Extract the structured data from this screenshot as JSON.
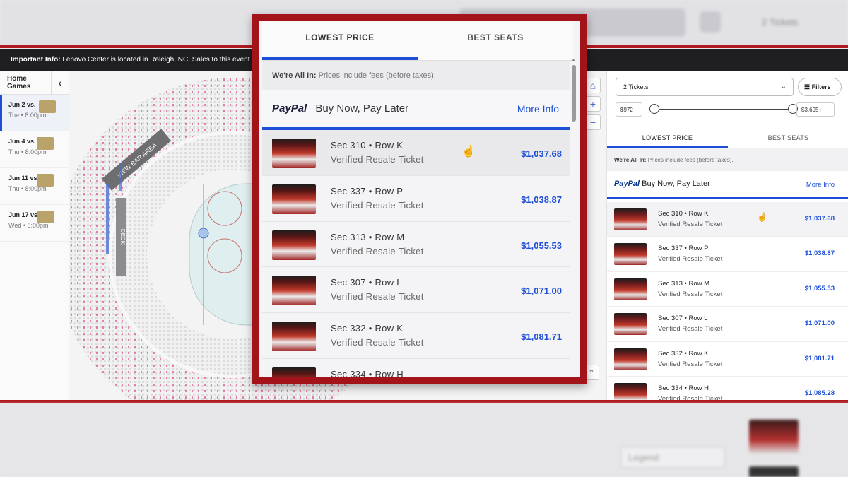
{
  "info_bar": {
    "label": "Important Info:",
    "text": "Lenovo Center is located in Raleigh, NC. Sales to this event will be"
  },
  "sidebar": {
    "title": "Home Games",
    "back_icon": "chevron-left-icon",
    "games": [
      {
        "opponent": "Jun 2 vs.",
        "when": "Tue • 8:00pm"
      },
      {
        "opponent": "Jun 4 vs.",
        "when": "Thu • 8:00pm"
      },
      {
        "opponent": "Jun 11 vs.",
        "when": "Thu • 8:00pm"
      },
      {
        "opponent": "Jun 17 vs.",
        "when": "Wed • 8:00pm"
      }
    ]
  },
  "map": {
    "labels": [
      "VIEW BAR AREA",
      "DECK"
    ]
  },
  "filters": {
    "quantity": "2 Tickets",
    "filters_label": "Filters",
    "price_min": "$972",
    "price_max": "$3,695+"
  },
  "tabs": {
    "lowest": "LOWEST PRICE",
    "best": "BEST SEATS"
  },
  "notice": {
    "bold": "We're All In:",
    "text": "Prices include fees (before taxes)."
  },
  "paypal": {
    "brand": "PayPal",
    "text": "Buy Now, Pay Later",
    "link": "More Info"
  },
  "listings": [
    {
      "section": "Sec 310 • Row K",
      "type": "Verified Resale Ticket",
      "price": "$1,037.68"
    },
    {
      "section": "Sec 337 • Row P",
      "type": "Verified Resale Ticket",
      "price": "$1,038.87"
    },
    {
      "section": "Sec 313 • Row M",
      "type": "Verified Resale Ticket",
      "price": "$1,055.53"
    },
    {
      "section": "Sec 307 • Row L",
      "type": "Verified Resale Ticket",
      "price": "$1,071.00"
    },
    {
      "section": "Sec 332 • Row K",
      "type": "Verified Resale Ticket",
      "price": "$1,081.71"
    },
    {
      "section": "Sec 334 • Row H",
      "type": "Verified Resale Ticket",
      "price": "$1,085.28"
    }
  ],
  "background": {
    "tickets_label": "2 Tickets",
    "legend_label": "Legend"
  },
  "colors": {
    "accent": "#1d4ed8",
    "frame": "#a3131a",
    "brand_red": "#b01a1e"
  }
}
